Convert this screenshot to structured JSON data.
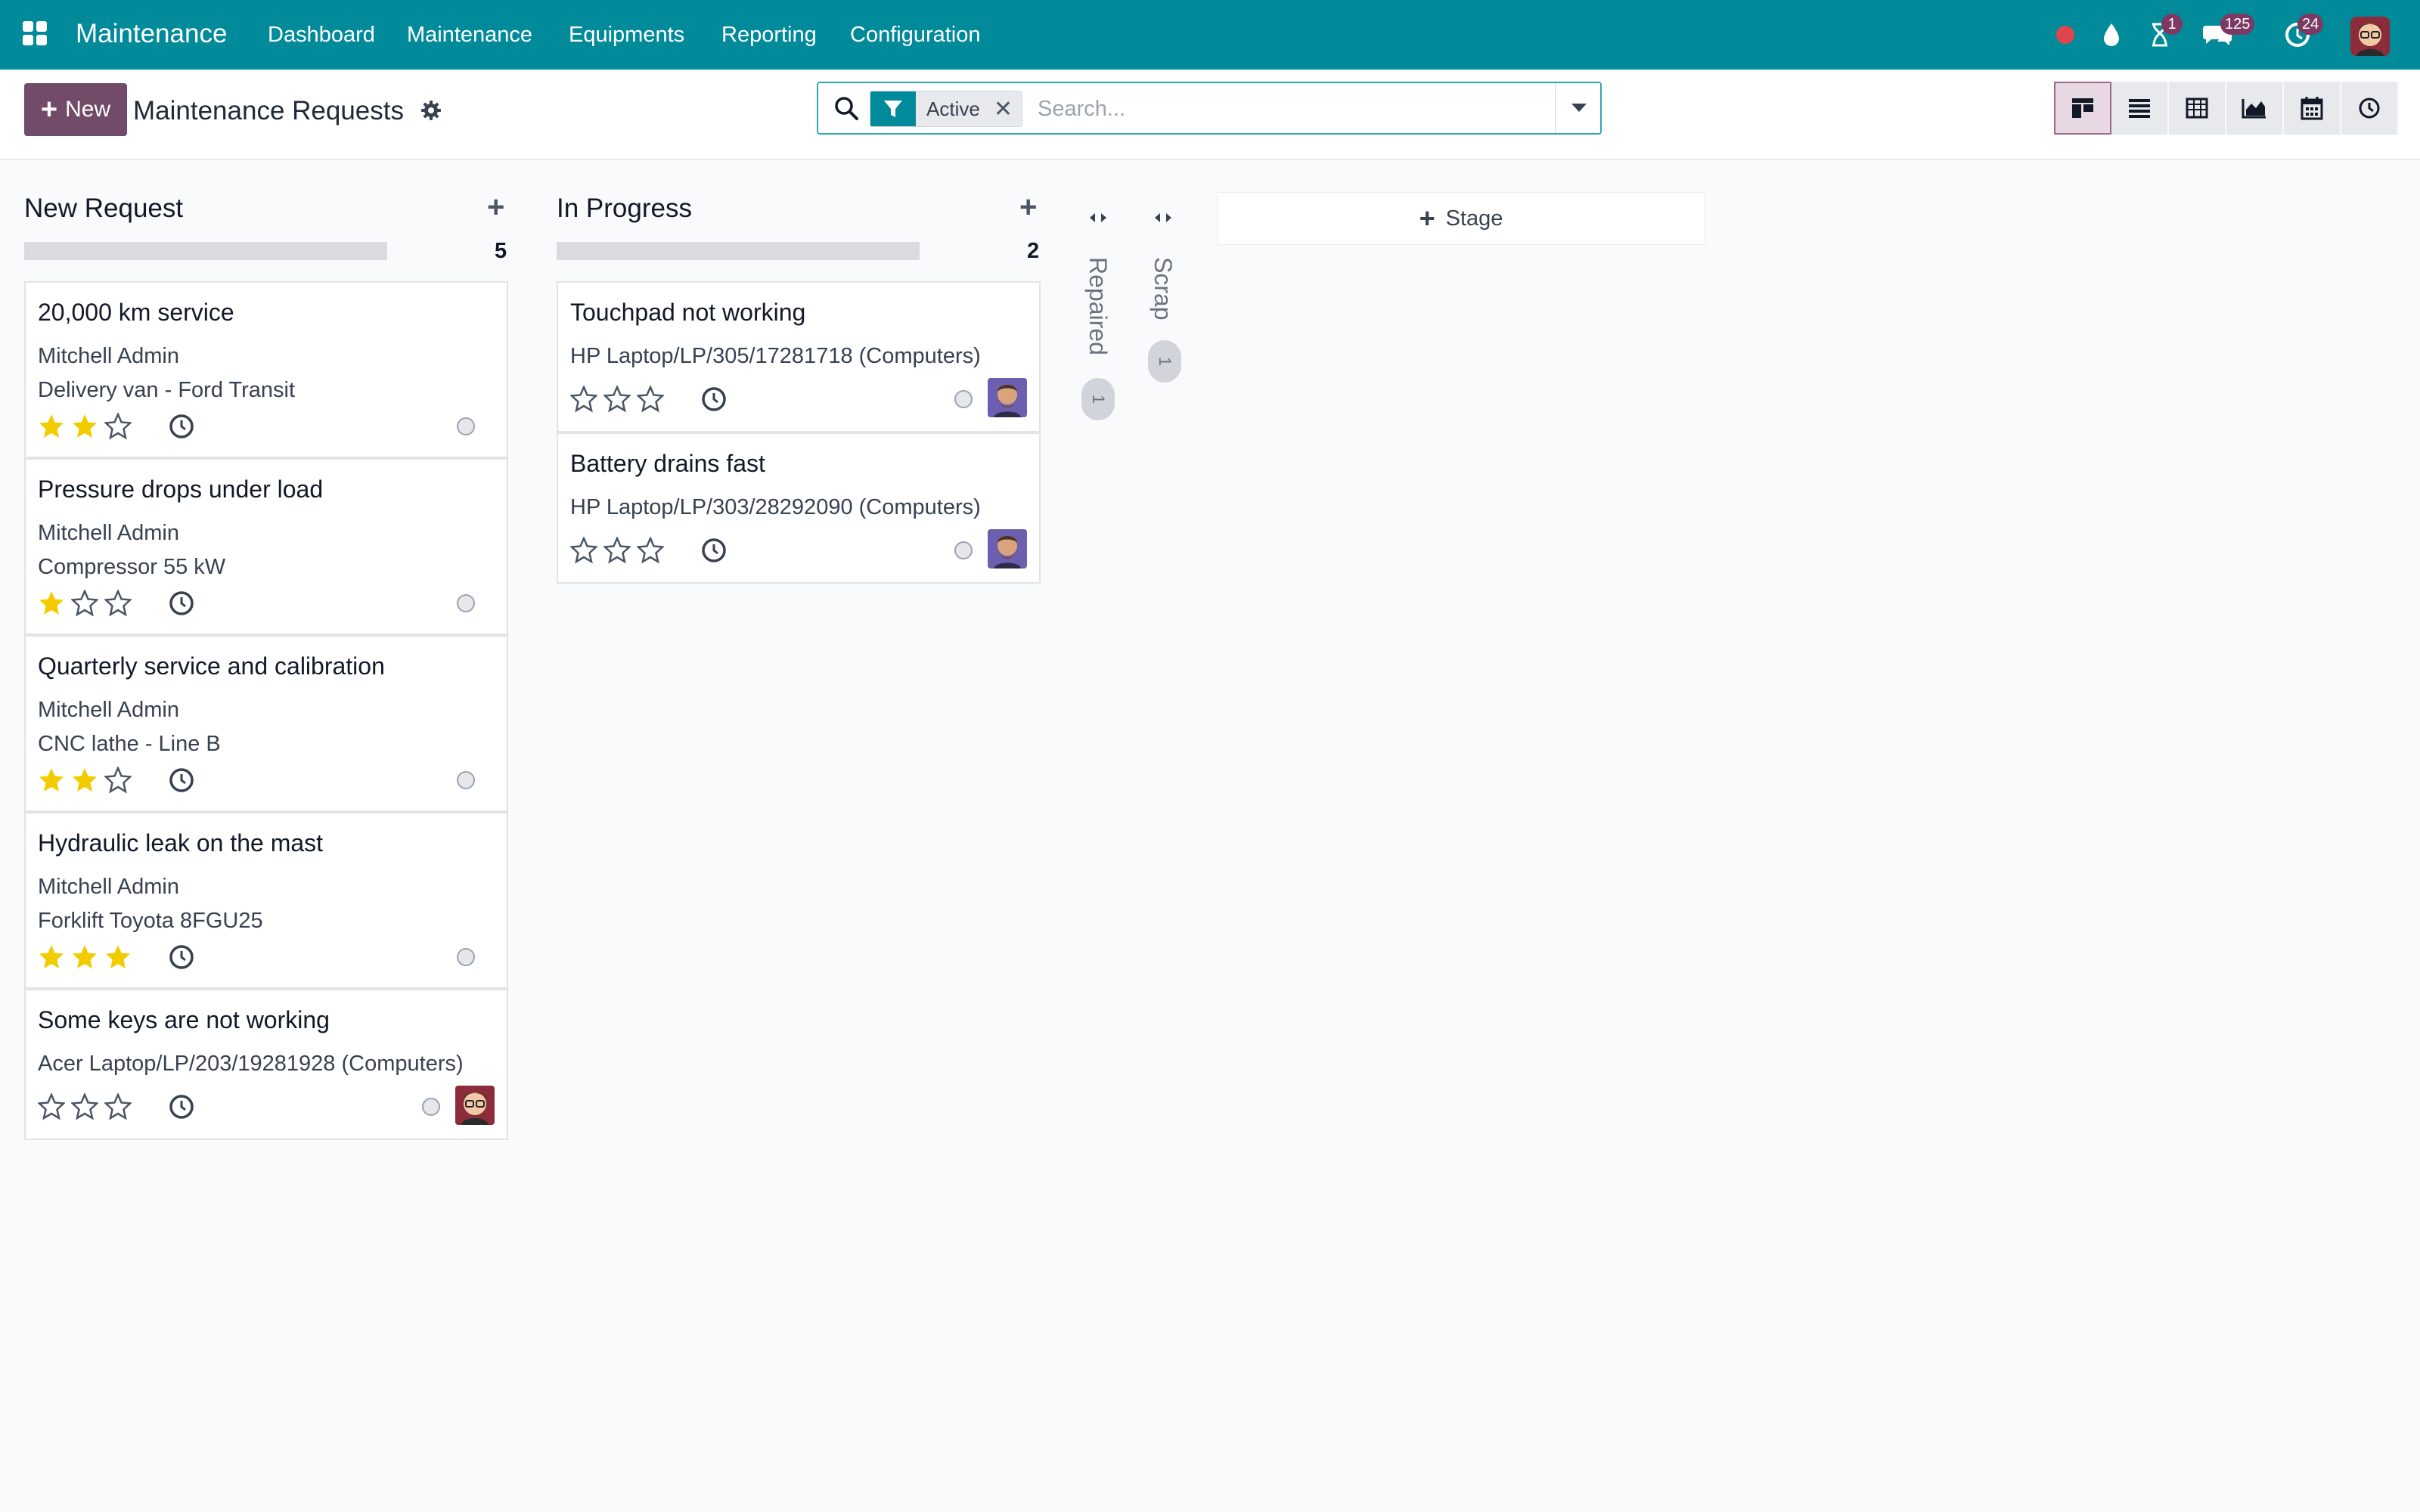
{
  "navbar": {
    "brand": "Maintenance",
    "menu": [
      "Dashboard",
      "Maintenance",
      "Equipments",
      "Reporting",
      "Configuration"
    ],
    "badges": {
      "activity": "1",
      "messages": "125",
      "updates": "24"
    }
  },
  "control_panel": {
    "new_label": "New",
    "title": "Maintenance Requests",
    "search": {
      "facet": "Active",
      "placeholder": "Search..."
    }
  },
  "columns": [
    {
      "title": "New Request",
      "count": "5",
      "cards": [
        {
          "title": "20,000 km service",
          "lines": [
            "Mitchell Admin",
            "Delivery van - Ford Transit"
          ],
          "stars": 2
        },
        {
          "title": "Pressure drops under load",
          "lines": [
            "Mitchell Admin",
            "Compressor 55 kW"
          ],
          "stars": 1
        },
        {
          "title": "Quarterly service and calibration",
          "lines": [
            "Mitchell Admin",
            "CNC lathe - Line B"
          ],
          "stars": 2
        },
        {
          "title": "Hydraulic leak on the mast",
          "lines": [
            "Mitchell Admin",
            "Forklift Toyota 8FGU25"
          ],
          "stars": 3
        },
        {
          "title": "Some keys are not working",
          "lines": [
            "Acer Laptop/LP/203/19281928 (Computers)"
          ],
          "stars": 0
        }
      ]
    },
    {
      "title": "In Progress",
      "count": "2",
      "cards": [
        {
          "title": "Touchpad not working",
          "lines": [
            "HP Laptop/LP/305/17281718 (Computers)"
          ],
          "stars": 0
        },
        {
          "title": "Battery drains fast",
          "lines": [
            "HP Laptop/LP/303/28292090 (Computers)"
          ],
          "stars": 0
        }
      ]
    }
  ],
  "folded_columns": [
    {
      "title": "Repaired",
      "count": "1"
    },
    {
      "title": "Scrap",
      "count": "1"
    }
  ],
  "add_stage_label": "Stage",
  "colors": {
    "navbar": "#018b9a",
    "primary": "#714b67",
    "star": "#f3cc00"
  }
}
